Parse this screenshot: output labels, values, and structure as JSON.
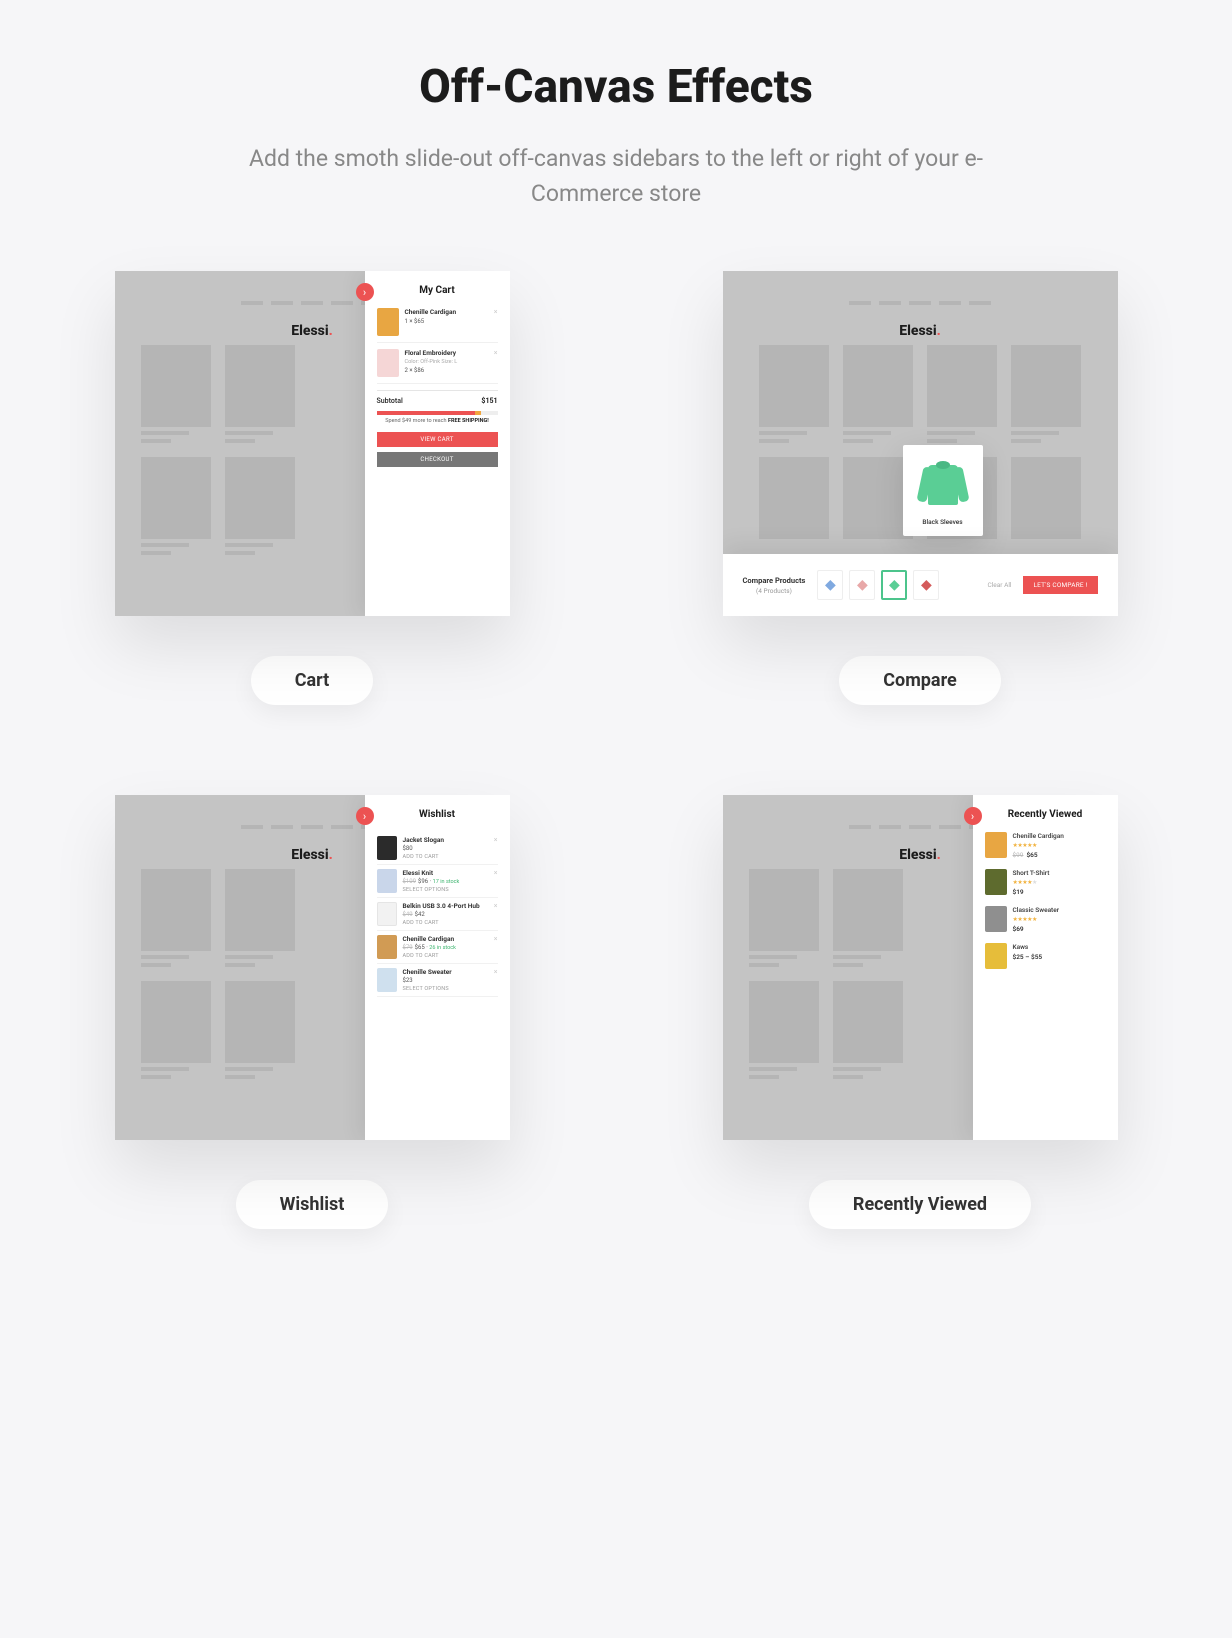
{
  "header": {
    "title": "Off-Canvas Effects",
    "subtitle": "Add the smoth slide-out off-canvas sidebars to the left or right of your e-Commerce store"
  },
  "brand": {
    "name": "Elessi",
    "dot": "."
  },
  "cards": {
    "cart": {
      "pill": "Cart",
      "panel_title": "My Cart",
      "items": [
        {
          "name": "Chenille Cardigan",
          "qty": "1 × $65",
          "meta": ""
        },
        {
          "name": "Floral Embroidery",
          "meta": "Color: Off-Pink\nSize: L",
          "qty": "2 × $86"
        }
      ],
      "subtotal_label": "Subtotal",
      "subtotal_value": "$151",
      "progress_text_prefix": "Spend $49 more to reach ",
      "progress_text_bold": "FREE SHIPPING!",
      "btn_view": "VIEW CART",
      "btn_checkout": "CHECKOUT"
    },
    "compare": {
      "pill": "Compare",
      "popup_name": "Black Sleeves",
      "strip_title": "Compare Products",
      "strip_count": "(4 Products)",
      "clear": "Clear All",
      "btn": "LET'S COMPARE !"
    },
    "wishlist": {
      "pill": "Wishlist",
      "panel_title": "Wishlist",
      "items": [
        {
          "name": "Jacket Slogan",
          "price": "$80",
          "action": "ADD TO CART"
        },
        {
          "name": "Elessi Knit",
          "old": "$109",
          "price": "$96 ·",
          "stock": "17 in stock",
          "action": "SELECT OPTIONS"
        },
        {
          "name": "Belkin USB 3.0 4-Port Hub",
          "old": "$49",
          "price": "$42",
          "action": "ADD TO CART"
        },
        {
          "name": "Chenille Cardigan",
          "old": "$79",
          "price": "$65 ·",
          "stock": "26 in stock",
          "action": "ADD TO CART"
        },
        {
          "name": "Chenille Sweater",
          "price": "$23",
          "action": "SELECT OPTIONS"
        }
      ]
    },
    "recent": {
      "pill": "Recently Viewed",
      "panel_title": "Recently Viewed",
      "items": [
        {
          "name": "Chenille Cardigan",
          "stars": 5,
          "old": "$99",
          "price": "$65"
        },
        {
          "name": "Short T-Shirt",
          "stars": 4,
          "price": "$19"
        },
        {
          "name": "Classic Sweater",
          "stars": 5,
          "price": "$69"
        },
        {
          "name": "Kaws",
          "stars": 0,
          "price": "$25 – $55"
        }
      ]
    }
  }
}
